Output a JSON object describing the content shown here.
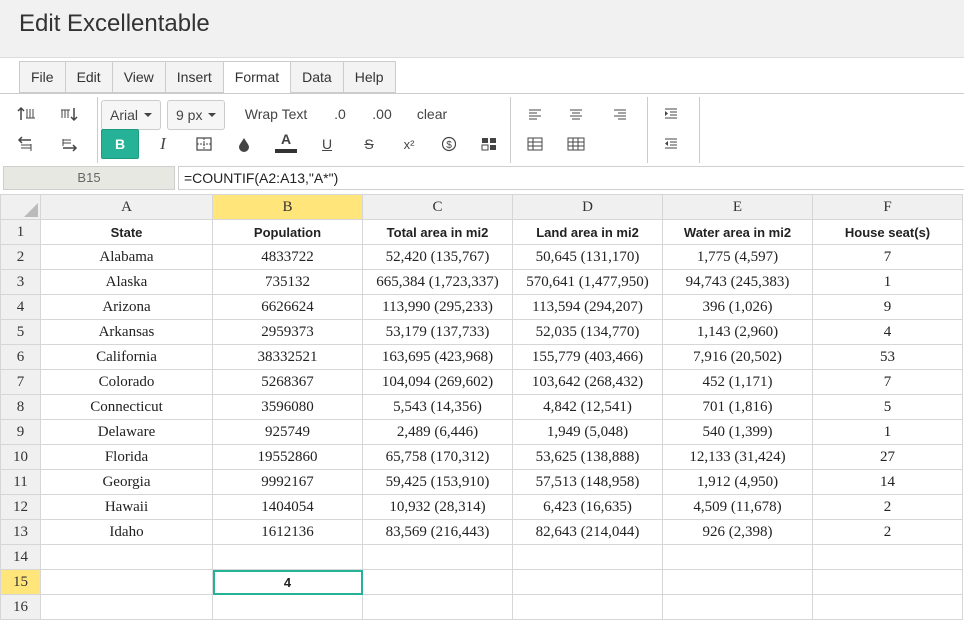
{
  "app": {
    "title": "Edit Excellentable"
  },
  "menu": [
    "File",
    "Edit",
    "View",
    "Insert",
    "Format",
    "Data",
    "Help"
  ],
  "menu_active": "Format",
  "toolbar": {
    "font_family": "Arial",
    "font_size": "9 px",
    "wrap_text": "Wrap Text",
    "decimal_decrease": ".0",
    "decimal_increase": ".00",
    "clear": "clear",
    "bold": "B",
    "italic": "I",
    "underline": "U",
    "strikethrough": "S",
    "superscript": "x²",
    "font_color": "A",
    "accent_color": "#26b296"
  },
  "formula_bar": {
    "cell_ref": "B15",
    "formula": "=COUNTIF(A2:A13,\"A*\")"
  },
  "sheet": {
    "columns": [
      "A",
      "B",
      "C",
      "D",
      "E",
      "F"
    ],
    "active_column": "B",
    "active_row": 15,
    "header_row": [
      "State",
      "Population",
      "Total area in mi2",
      "Land area in mi2",
      "Water area in mi2",
      "House seat(s)"
    ],
    "rows": [
      [
        "Alabama",
        "4833722",
        "52,420 (135,767)",
        "50,645 (131,170)",
        "1,775 (4,597)",
        "7"
      ],
      [
        "Alaska",
        "735132",
        "665,384 (1,723,337)",
        "570,641 (1,477,950)",
        "94,743 (245,383)",
        "1"
      ],
      [
        "Arizona",
        "6626624",
        "113,990 (295,233)",
        "113,594 (294,207)",
        "396 (1,026)",
        "9"
      ],
      [
        "Arkansas",
        "2959373",
        "53,179 (137,733)",
        "52,035 (134,770)",
        "1,143 (2,960)",
        "4"
      ],
      [
        "California",
        "38332521",
        "163,695 (423,968)",
        "155,779 (403,466)",
        "7,916 (20,502)",
        "53"
      ],
      [
        "Colorado",
        "5268367",
        "104,094 (269,602)",
        "103,642 (268,432)",
        "452 (1,171)",
        "7"
      ],
      [
        "Connecticut",
        "3596080",
        "5,543 (14,356)",
        "4,842 (12,541)",
        "701 (1,816)",
        "5"
      ],
      [
        "Delaware",
        "925749",
        "2,489 (6,446)",
        "1,949 (5,048)",
        "540 (1,399)",
        "1"
      ],
      [
        "Florida",
        "19552860",
        "65,758 (170,312)",
        "53,625 (138,888)",
        "12,133 (31,424)",
        "27"
      ],
      [
        "Georgia",
        "9992167",
        "59,425 (153,910)",
        "57,513 (148,958)",
        "1,912 (4,950)",
        "14"
      ],
      [
        "Hawaii",
        "1404054",
        "10,932 (28,314)",
        "6,423 (16,635)",
        "4,509 (11,678)",
        "2"
      ],
      [
        "Idaho",
        "1612136",
        "83,569 (216,443)",
        "82,643 (214,044)",
        "926 (2,398)",
        "2"
      ]
    ],
    "row15_value": "4",
    "row_numbers": [
      "1",
      "2",
      "3",
      "4",
      "5",
      "6",
      "7",
      "8",
      "9",
      "10",
      "11",
      "12",
      "13",
      "14",
      "15",
      "16"
    ]
  }
}
